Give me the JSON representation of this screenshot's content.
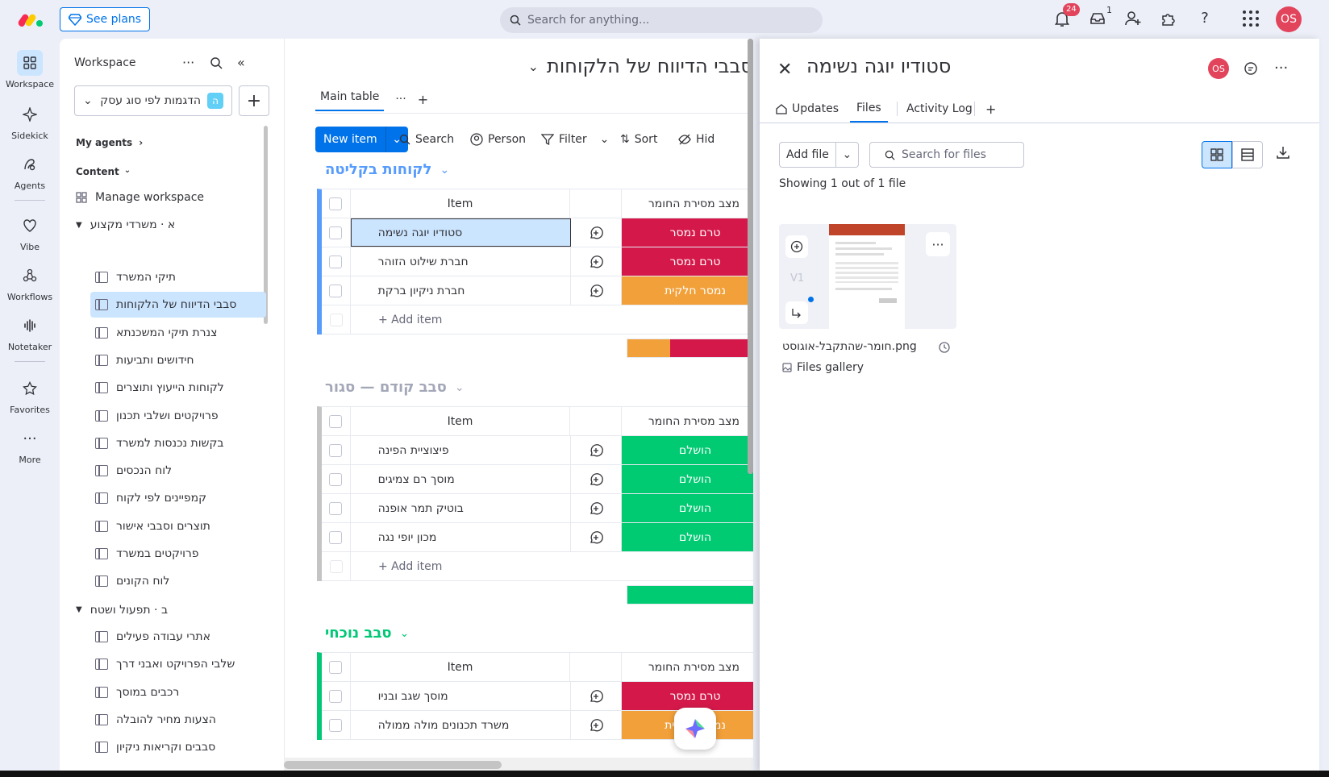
{
  "topbar": {
    "see_plans": "See plans",
    "search_placeholder": "Search for anything...",
    "notifications_count": "24",
    "inbox_count": "1",
    "avatar_initials": "OS"
  },
  "rail": {
    "items": [
      {
        "label": "Workspace"
      },
      {
        "label": "Sidekick"
      },
      {
        "label": "Agents"
      },
      {
        "label": "Vibe"
      },
      {
        "label": "Workflows"
      },
      {
        "label": "Notetaker"
      },
      {
        "label": "Favorites"
      },
      {
        "label": "More"
      }
    ]
  },
  "workspace": {
    "title": "Workspace",
    "selected_workspace": "הדגמות לפי סוג עסק",
    "workspace_badge": "ה",
    "my_agents": "My agents",
    "content": "Content",
    "manage": "Manage workspace",
    "group_a": "א · משרדי מקצוע",
    "group_b": "ב · תפעול ושטח",
    "boards_a": [
      "תיקי המשרד",
      "סבבי הדיווח של הלקוחות",
      "צנרת תיקי המשכנתא",
      "חידושים ותביעות",
      "לקוחות הייעוץ ותוצרים",
      "פרויקטים ושלבי תכנון",
      "בקשות נכנסות למשרד",
      "לוח הנכסים",
      "קמפיינים לפי לקוח",
      "תוצרים וסבבי אישור",
      "פרויקטים במשרד",
      "לוח הקונים"
    ],
    "boards_b": [
      "אתרי עבודה פעילים",
      "שלבי הפרויקט ואבני דרך",
      "רכבים במוסך",
      "הצעות מחיר להובלה",
      "סבבים וקריאות ניקיון"
    ]
  },
  "board": {
    "title": "סבבי הדיווח של הלקוחות",
    "tab_main": "Main table",
    "new_item": "New item",
    "tools": {
      "search": "Search",
      "person": "Person",
      "filter": "Filter",
      "sort": "Sort",
      "hide": "Hid"
    },
    "col_item": "Item",
    "col_status": "מצב מסירת החומר",
    "add_item": "+ Add item",
    "groups": [
      {
        "title": "לקוחות בקליטה",
        "color": "#579bfc",
        "rows": [
          {
            "name": "סטודיו יוגה נשימה",
            "status": "טרם נמסר",
            "color": "#d4194a"
          },
          {
            "name": "חברת שילוט הזוהר",
            "status": "טרם נמסר",
            "color": "#d4194a"
          },
          {
            "name": "חברת ניקיון ברקת",
            "status": "נמסר חלקית",
            "color": "#f2a03a"
          }
        ]
      },
      {
        "title": "סבב קודם — סגור",
        "color": "#c4c4c4",
        "rows": [
          {
            "name": "פיצוציית הפינה",
            "status": "הושלם",
            "color": "#00ca72"
          },
          {
            "name": "מוסך רם צמיגים",
            "status": "הושלם",
            "color": "#00ca72"
          },
          {
            "name": "בוטיק תמר אופנה",
            "status": "הושלם",
            "color": "#00ca72"
          },
          {
            "name": "מכון יופי נגה",
            "status": "הושלם",
            "color": "#00ca72"
          }
        ]
      },
      {
        "title": "סבב נוכחי",
        "color": "#00c875",
        "rows": [
          {
            "name": "מוסך שגב ובניו",
            "status": "טרם נמסר",
            "color": "#d4194a"
          },
          {
            "name": "משרד תכנונים מולה ממולה",
            "status": "נמסר חלקית",
            "color": "#f2a03a"
          }
        ]
      }
    ]
  },
  "detail": {
    "title": "סטודיו יוגה נשימה",
    "avatar": "OS",
    "tabs": {
      "updates": "Updates",
      "files": "Files",
      "activity": "Activity Log",
      "add": "+"
    },
    "add_file": "Add file",
    "search_files": "Search for files",
    "showing": "Showing 1 out of 1 file",
    "file_version": "V1",
    "file_name": "חומר-שהתקבל-אוגוסט.png",
    "file_gallery": "Files gallery"
  }
}
